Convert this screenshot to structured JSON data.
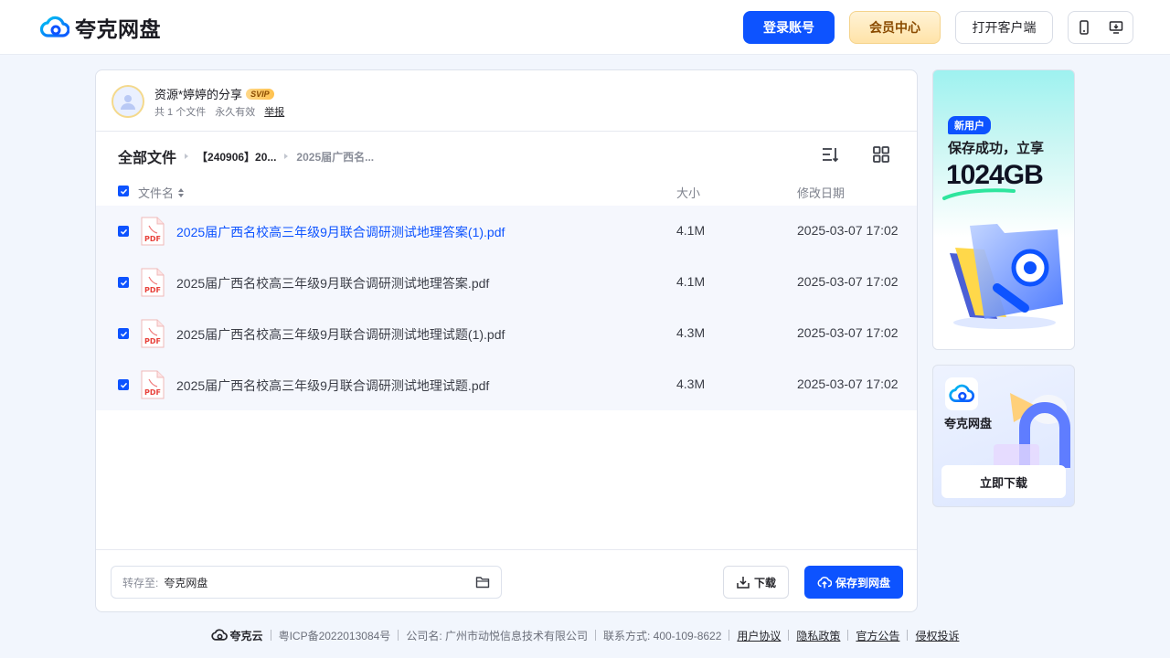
{
  "header": {
    "logo_text": "夸克网盘",
    "login_label": "登录账号",
    "vip_label": "会员中心",
    "client_label": "打开客户端"
  },
  "share": {
    "title": "资源*婷婷的分享",
    "badge": "SVIP",
    "file_count": "共 1 个文件",
    "validity": "永久有效",
    "report": "举报"
  },
  "breadcrumb": {
    "root": "全部文件",
    "items": [
      "【240906】20...",
      "2025届广西名..."
    ]
  },
  "columns": {
    "name": "文件名",
    "size": "大小",
    "date": "修改日期"
  },
  "files": [
    {
      "name": "2025届广西名校高三年级9月联合调研测试地理答案(1).pdf",
      "size": "4.1M",
      "date": "2025-03-07 17:02"
    },
    {
      "name": "2025届广西名校高三年级9月联合调研测试地理答案.pdf",
      "size": "4.1M",
      "date": "2025-03-07 17:02"
    },
    {
      "name": "2025届广西名校高三年级9月联合调研测试地理试题(1).pdf",
      "size": "4.3M",
      "date": "2025-03-07 17:02"
    },
    {
      "name": "2025届广西名校高三年级9月联合调研测试地理试题.pdf",
      "size": "4.3M",
      "date": "2025-03-07 17:02"
    }
  ],
  "footer_bar": {
    "save_to_label": "转存至:",
    "save_to_value": "夸克网盘",
    "download": "下载",
    "save": "保存到网盘"
  },
  "ads": {
    "ad1_badge": "新用户",
    "ad1_line1": "保存成功，立享",
    "ad1_big": "1024GB",
    "ad2_name": "夸克网盘",
    "ad2_button": "立即下载"
  },
  "page_footer": {
    "brand": "夸克云",
    "icp": "粤ICP备2022013084号",
    "company": "公司名: 广州市动悦信息技术有限公司",
    "contact": "联系方式: 400-109-8622",
    "links": [
      "用户协议",
      "隐私政策",
      "官方公告",
      "侵权投诉"
    ]
  },
  "colors": {
    "primary": "#0d53ff",
    "vip": "#ffe3a8",
    "background": "#f2f6fd"
  }
}
